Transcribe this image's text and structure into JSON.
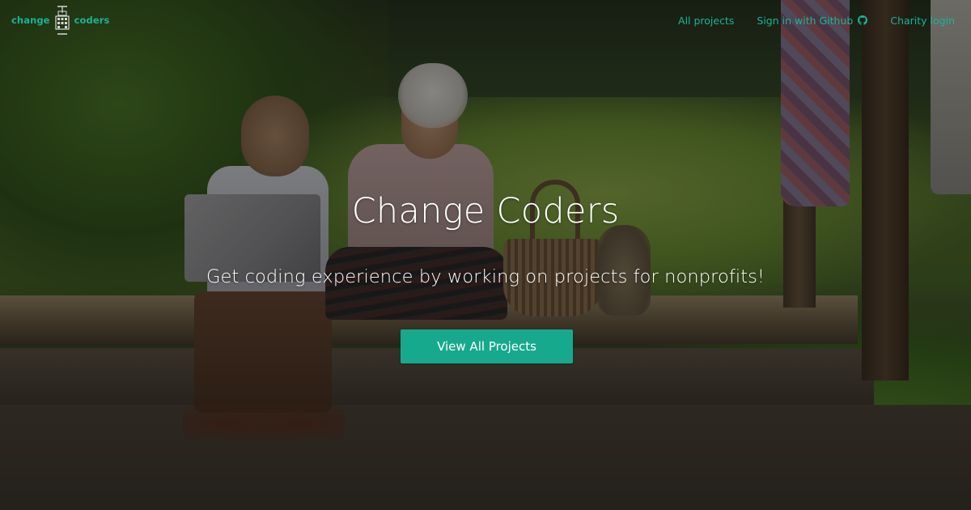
{
  "colors": {
    "accent": "#1ab39a",
    "button_bg": "#17a98e",
    "hero_text": "#ffffff"
  },
  "navbar": {
    "brand": {
      "left_text": "change",
      "right_text": "coders",
      "logo_icon": "building-icon"
    },
    "links": [
      {
        "label": "All projects"
      },
      {
        "label": "Sign in with Github",
        "icon": "github-icon"
      },
      {
        "label": "Charity login"
      }
    ]
  },
  "hero": {
    "background_image": "boy with laptop and elderly woman in rural field",
    "title": "Change Coders",
    "subtitle": "Get coding experience by working on projects for nonprofits!",
    "cta_label": "View All Projects"
  }
}
